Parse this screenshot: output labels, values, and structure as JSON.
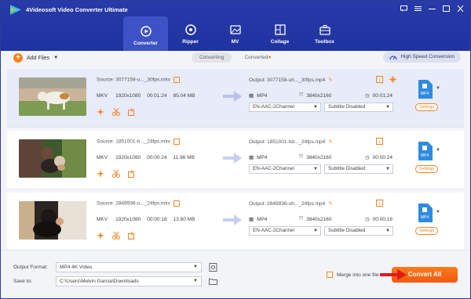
{
  "app": {
    "title": "4Videosoft Video Converter Ultimate",
    "accent": "#f5831f",
    "header_color": "#2438a6"
  },
  "window_controls": [
    "chat-icon",
    "menu-icon",
    "minimize-icon",
    "maximize-icon",
    "close-icon"
  ],
  "tabs": [
    {
      "label": "Converter",
      "icon": "converter-icon",
      "active": true
    },
    {
      "label": "Ripper",
      "icon": "disc-icon",
      "active": false
    },
    {
      "label": "MV",
      "icon": "mv-icon",
      "active": false
    },
    {
      "label": "Collage",
      "icon": "collage-icon",
      "active": false
    },
    {
      "label": "Toolbox",
      "icon": "toolbox-icon",
      "active": false
    }
  ],
  "toolbar": {
    "add_files": "Add Files",
    "seg_converting": "Converting",
    "seg_converted": "Converted",
    "high_speed": "High Speed Conversion"
  },
  "files": [
    {
      "source": "Source: 3077158-u..._30fps.mkv",
      "format": "MKV",
      "resolution": "1920x1080",
      "duration": "00:01:24",
      "size": "85.04 MB",
      "output": "Output: 3077158-uh..._30fps.mp4",
      "out_format": "MP4",
      "out_resolution": "3840x2160",
      "out_duration": "00:01:24",
      "audio": "EN-AAC-2Channel",
      "subtitle": "Subtitle Disabled",
      "settings": "Settings",
      "badge": "MP4",
      "selected": true
    },
    {
      "source": "Source: 1851001-h..._24fps.mkv",
      "format": "MKV",
      "resolution": "1920x1080",
      "duration": "00:00:24",
      "size": "11.96 MB",
      "output": "Output: 1851001-hd..._24fps.mp4",
      "out_format": "MP4",
      "out_resolution": "3840x2160",
      "out_duration": "00:00:24",
      "audio": "EN-AAC-2Channel",
      "subtitle": "Subtitle Disabled",
      "settings": "Settings",
      "badge": "MP4",
      "selected": false
    },
    {
      "source": "Source: 2849936-u..._24fps.mkv",
      "format": "MKV",
      "resolution": "1920x1080",
      "duration": "00:00:18",
      "size": "13.60 MB",
      "output": "Output: 2849936-uh..._24fps.mp4",
      "out_format": "MP4",
      "out_resolution": "3840x2160",
      "out_duration": "00:00:18",
      "audio": "EN-AAC-2Channel",
      "subtitle": "Subtitle Disabled",
      "settings": "Settings",
      "badge": "MP4",
      "selected": false
    }
  ],
  "bottom": {
    "output_format_label": "Output Format:",
    "output_format_value": "MP4 4K Video",
    "save_to_label": "Save to:",
    "save_to_value": "C:\\Users\\Melvin Garcia\\Downloads",
    "merge_label": "Merge into one file",
    "convert_all": "Convert All"
  }
}
